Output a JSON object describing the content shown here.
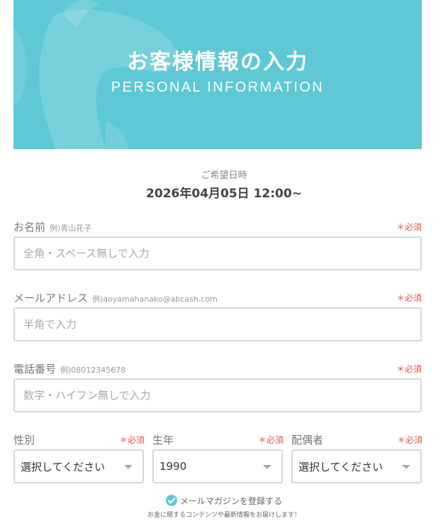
{
  "hero": {
    "title": "お客様情報の入力",
    "subtitle": "PERSONAL INFORMATION",
    "bg_color": "#5ec8d5",
    "decoration": "dolphin-silhouette"
  },
  "date": {
    "label": "ご希望日時",
    "value": "2026年04月05日 12:00~"
  },
  "required_label": "＊必須",
  "fields": {
    "name": {
      "label": "お名前",
      "example": "例)青山花子",
      "placeholder": "全角・スペース無しで入力"
    },
    "email": {
      "label": "メールアドレス",
      "example": "例)aoyamahanako@abcash.com",
      "placeholder": "半角で入力"
    },
    "phone": {
      "label": "電話番号",
      "example": "例)08012345678",
      "placeholder": "数字・ハイフン無しで入力"
    }
  },
  "selects": {
    "gender": {
      "label": "性別",
      "value": "選択してください"
    },
    "birth_year": {
      "label": "生年",
      "value": "1990"
    },
    "spouse": {
      "label": "配偶者",
      "value": "選択してください"
    }
  },
  "newsletter": {
    "label": "メールマガジンを登録する",
    "note": "お金に関するコンテンツや最新情報をお届けします！",
    "checked": true
  },
  "colors": {
    "accent": "#5ec8d5",
    "required": "#e0544f",
    "border": "#d7d7d7"
  }
}
